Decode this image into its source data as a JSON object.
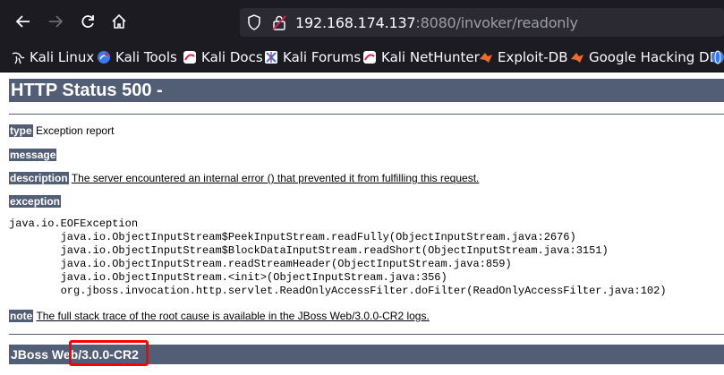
{
  "browser": {
    "url_host": "192.168.174.137",
    "url_rest": ":8080/invoker/readonly",
    "bookmarks": [
      {
        "label": "Kali Linux",
        "icon": "kali-dragon-icon"
      },
      {
        "label": "Kali Tools",
        "icon": "kali-tools-icon"
      },
      {
        "label": "Kali Docs",
        "icon": "kali-docs-icon"
      },
      {
        "label": "Kali Forums",
        "icon": "kali-forums-icon"
      },
      {
        "label": "Kali NetHunter",
        "icon": "kali-nethunter-icon"
      },
      {
        "label": "Exploit-DB",
        "icon": "exploit-db-icon"
      },
      {
        "label": "Google Hacking DB",
        "icon": "ghdb-icon"
      }
    ]
  },
  "page": {
    "title": "HTTP Status 500 -",
    "type_label": "type",
    "type_value": "Exception report",
    "message_label": "message",
    "description_label": "description",
    "description_value": "The server encountered an internal error () that prevented it from fulfilling this request.",
    "exception_label": "exception",
    "stack_trace": "java.io.EOFException\n\tjava.io.ObjectInputStream$PeekInputStream.readFully(ObjectInputStream.java:2676)\n\tjava.io.ObjectInputStream$BlockDataInputStream.readShort(ObjectInputStream.java:3151)\n\tjava.io.ObjectInputStream.readStreamHeader(ObjectInputStream.java:859)\n\tjava.io.ObjectInputStream.<init>(ObjectInputStream.java:356)\n\torg.jboss.invocation.http.servlet.ReadOnlyAccessFilter.doFilter(ReadOnlyAccessFilter.java:102)",
    "note_label": "note",
    "note_value": "The full stack trace of the root cause is available in the JBoss Web/3.0.0-CR2 logs.",
    "footer": "JBoss Web/3.0.0-CR2"
  },
  "colors": {
    "tomcat_bar": "#525d76",
    "highlight": "#ff0000"
  }
}
